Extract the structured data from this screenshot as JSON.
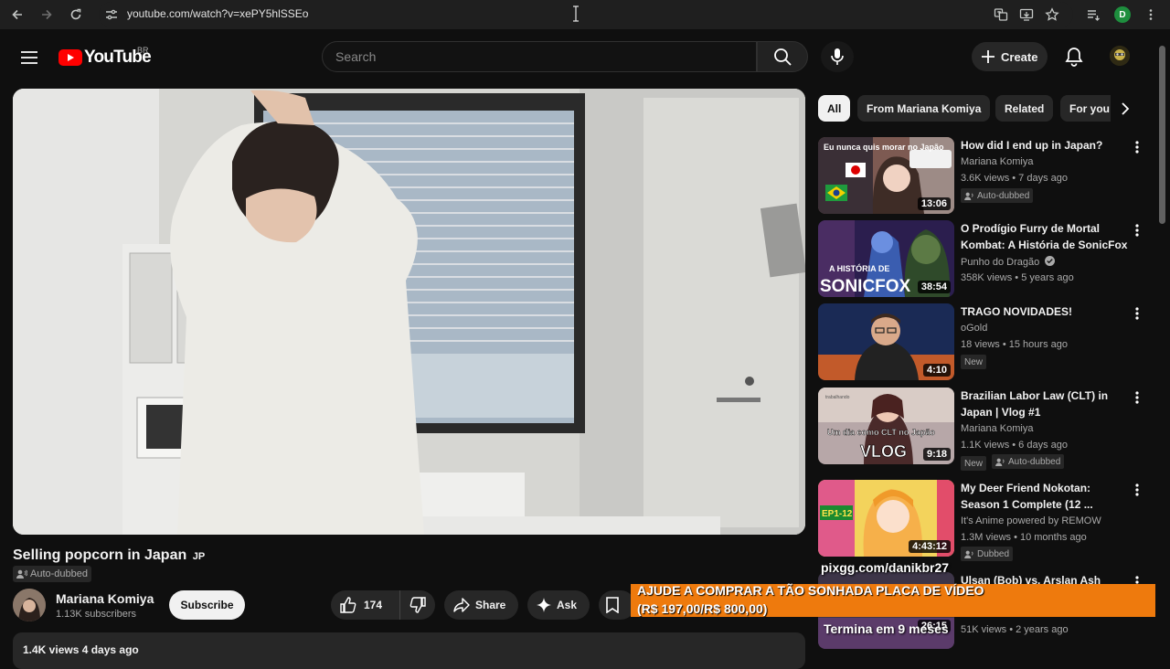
{
  "browser": {
    "url": "youtube.com/watch?v=xePY5hlSSEo",
    "profile_initial": "D",
    "profile_color": "#1e8e3e"
  },
  "header": {
    "logo_text": "YouTube",
    "country_code": "BR",
    "search_placeholder": "Search",
    "create_label": "Create"
  },
  "video": {
    "title": "Selling popcorn in Japan",
    "title_lang": "JP",
    "auto_dubbed_label": "Auto-dubbed",
    "channel_name": "Mariana Komiya",
    "subscribers": "1.13K subscribers",
    "subscribe_label": "Subscribe",
    "likes": "174",
    "share_label": "Share",
    "ask_label": "Ask",
    "views_date": "1.4K views  4 days ago"
  },
  "chips": [
    {
      "label": "All",
      "active": true
    },
    {
      "label": "From Mariana Komiya",
      "active": false
    },
    {
      "label": "Related",
      "active": false
    },
    {
      "label": "For you",
      "active": false
    }
  ],
  "recommendations": [
    {
      "title": "How did I end up in Japan?",
      "channel": "Mariana Komiya",
      "meta": "3.6K views • 7 days ago",
      "badge": "Auto-dubbed",
      "duration": "13:06",
      "thumb_text": "Eu nunca quis morar no Japão"
    },
    {
      "title": "O Prodígio Furry de Mortal Kombat: A História de SonicFox",
      "channel": "Punho do Dragão",
      "meta": "358K views • 5 years ago",
      "duration": "38:54",
      "thumb_text_small": "A HISTÓRIA DE",
      "thumb_text": "SONICFOX"
    },
    {
      "title": "TRAGO NOVIDADES!",
      "channel": "oGold",
      "meta": "18 views • 15 hours ago",
      "new_label": "New",
      "duration": "4:10"
    },
    {
      "title": "Brazilian Labor Law (CLT) in Japan | Vlog #1",
      "channel": "Mariana Komiya",
      "meta": "1.1K views • 6 days ago",
      "new_label": "New",
      "badge": "Auto-dubbed",
      "duration": "9:18",
      "thumb_text_small": "Um dia como CLT no Japão",
      "thumb_text": "VLOG"
    },
    {
      "title": "My Deer Friend Nokotan: Season 1 Complete (12 ...",
      "channel": "It's Anime powered by REMOW",
      "meta": "1.3M views • 10 months ago",
      "badge": "Dubbed",
      "duration": "4:43:12",
      "thumb_text": "EP1-12"
    },
    {
      "title": "Ulsan (Bob) vs. Arslan Ash",
      "meta": "51K views • 2 years ago",
      "duration": "26:15"
    }
  ],
  "overlay": {
    "url": "pixgg.com/danikbr27",
    "line1": "AJUDE A COMPRAR A TÃO SONHADA PLACA DE VÍDEO",
    "line2": "(R$ 197,00/R$ 800,00)",
    "progress_fraction": 0.246,
    "countdown": "Termina em 9 meses"
  },
  "colors": {
    "background": "#0f0f0f",
    "youtube_red": "#ff0000",
    "overlay_orange": "#ee7a0d"
  }
}
